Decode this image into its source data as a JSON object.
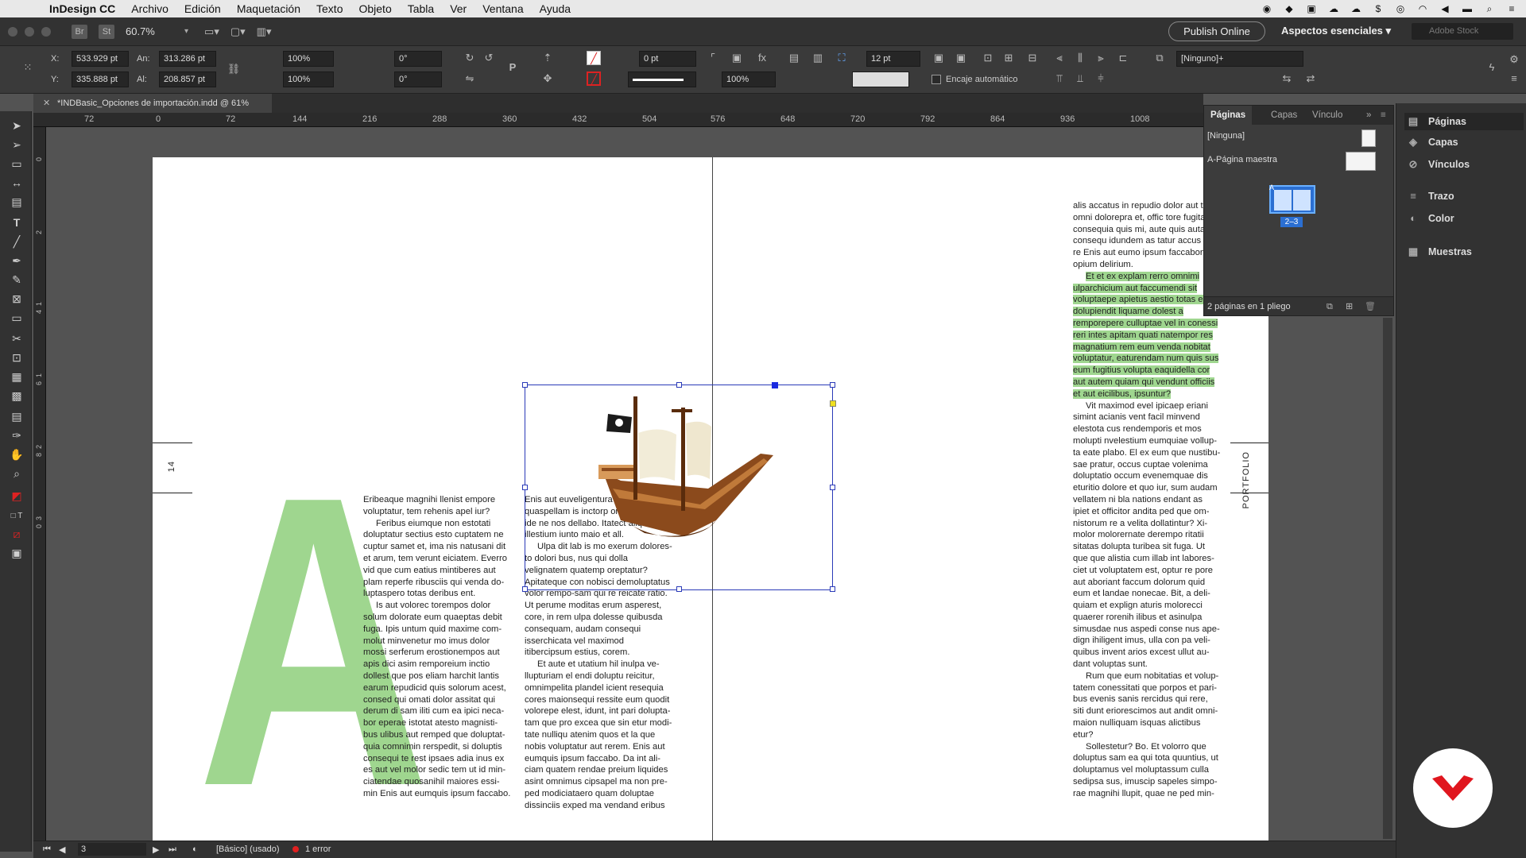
{
  "menubar": {
    "app": "InDesign CC",
    "items": [
      "Archivo",
      "Edición",
      "Maquetación",
      "Texto",
      "Objeto",
      "Tabla",
      "Ver",
      "Ventana",
      "Ayuda"
    ]
  },
  "appbar": {
    "bridge": "Br",
    "stock": "St",
    "zoom": "60.7%",
    "publish": "Publish Online",
    "workspace": "Aspectos esenciales",
    "search_placeholder": "Adobe Stock"
  },
  "control": {
    "x_label": "X:",
    "x_value": "533.929 pt",
    "y_label": "Y:",
    "y_value": "335.888 pt",
    "w_label": "An:",
    "w_value": "313.286 pt",
    "h_label": "Al:",
    "h_value": "208.857 pt",
    "scale_x": "100%",
    "scale_y": "100%",
    "angle": "0°",
    "shear": "0°",
    "stroke_weight": "0 pt",
    "opacity": "100%",
    "spacing": "12 pt",
    "style": "[Ninguno]+",
    "autofit_label": "Encaje automático"
  },
  "document": {
    "tab_title": "*INDBasic_Opciones de importación.indd @ 61%"
  },
  "ruler": {
    "h_ticks": [
      "72",
      "0",
      "72",
      "144",
      "216",
      "288",
      "360",
      "432",
      "504",
      "576",
      "648",
      "720",
      "792",
      "864",
      "936",
      "1008"
    ],
    "v_ticks": [
      "0",
      "2",
      "1",
      "4",
      "1",
      "6",
      "2",
      "8",
      "3",
      "0",
      "3",
      "2",
      "3",
      "4",
      "3",
      "6",
      "3",
      "8"
    ]
  },
  "spread": {
    "big_letter": "A",
    "left_folio": "14",
    "right_label": "PORTFOLIO",
    "col1": [
      "Eribeaque magnihi llenist empore voluptatur, tem rehenis apel iur?",
      "Feribus eiumque non estotati doluptatur sectius esto cuptatem ne cuptur samet et, ima nis natusani dit et arum, tem verunt eiciatem. Everro vid que cum eatius mintiberes aut plam reperfe ribusciis qui venda do-luptaspero totas deribus ent.",
      "Is aut volorec torempos dolor solum dolorate eum quaeptas debit fuga. Ipis untum quid maxime com-molut minvenetur mo imus dolor mossi serferum erostionempos aut apis dici asim remporeium inctio dollest que pos eliam harchit lantis earum repudicid quis solorum acest, consed qui omati dolor assitat qui derum di sam iliti cum ea ipici neca-bor eperae istotat atesto magnisti-bus ulibus aut remped que doluptat-quia comnimin rerspedit, si doluptis consequi te rest ipsaes adia inus ex es aut vel molor sedic tem ut id min-ciatendae quosanihil maiores essi-min Enis aut eumquis ipsum faccabo."
    ],
    "col2": [
      "Enis aut euveligentura cumquia quaspellam is inctorp orempori del ide ne nos dellabo. Itatect aliquidu illestium iunto maio et all.",
      "Ulpa dit lab is mo exerum dolores-to dolori bus, nus qui dolla velignatem quatemp oreptatur? Apitateque con nobisci demoluptatus volor rempo-sam qui re reicate ratio. Ut perume moditas erum asperest, core, in rem ulpa dolesse quibusda consequam, audam consequi isserchicata vel maximod itibercipsum estius, corem.",
      "Et aute et utatium hil inulpa ve-llupturiam el endi doluptu reicitur, omnimpelita plandel icient resequia cores maionsequi ressite eum quodit volorepe elest, idunt, int pari dolupta-tam que pro excea que sin etur modi-tate nulliqu atenim quos et la que nobis voluptatur aut rerem. Enis aut eumquis ipsum faccabo. Da int ali-ciam quatem rendae preium liquides asint omnimus cipsapel ma non pre-ped modiciataero quam doluptae dissinciis exped ma vendand eribus"
    ],
    "col3_top": "alis accatus in repudio dolor aut ti tet omni dolorepra et, offic tore fugitam, consequia quis mi, aute quis autatia consequ idundem as tatur accus dias re Enis aut eumo ipsum faccabortex opium delirium.",
    "col3_highlight": "Et et ex explam rerro omnimi ulparchicium aut faccumendi sit voluptaepe apietus aestio totas e dae dolupiendit liquame dolest a remporepere culluptae vel in conessi reri intes apitam quati natempor res magnatium rem eum venda nobitat voluptatur, eaturendam num quis sus eum fugitius volupta eaquidella cor aut autem quiam qui vendunt officiis et aut eicilibus, ipsuntur?",
    "col3_rest": [
      "Vit maximod evel ipicaep eriani simint acianis vent facil minvend elestota cus rendemporis et mos molupti nvelestium eumquiae vollup-ta eate plabo. El ex eum que nustibu-sae pratur, occus cuptae volenima doluptatio occum evenemquae dis eturitio dolore et quo iur, sum audam vellatem ni bla nations endant as ipiet et officitor andita ped que om-nistorum re a velita dollatintur? Xi-molor molorernate derempo ritatii sitatas dolupta turibea sit fuga. Ut que que alistia cum illab int labores-ciet ut voluptatem est, optur re pore aut aboriant faccum dolorum quid eum et landae nonecae. Bit, a deli-quiam et explign aturis molorecci quaerer rorenih ilibus et asinulpa simusdae nus aspedi conse nus ape-dign ihiligent imus, ulla con pa veli-quibus invent arios excest ullut au-dant voluptas sunt.",
      "Rum que eum nobitatias et volup-tatem conessitati que porpos et pari-bus evenis sanis rercidus qui rere, siti dunt eriorescimos aut andit omni-maion nulliquam isquas alictibus etur?",
      "Sollestetur? Bo. Et volorro que doluptus sam ea qui tota quuntius, ut doluptamus vel moluptassum culla sedipsa sus, imuscip sapeles simpo-rae magnihi llupit, quae ne ped min-"
    ]
  },
  "pages_panel": {
    "tabs": [
      "Páginas",
      "Capas",
      "Vínculo"
    ],
    "none_label": "[Ninguna]",
    "master_label": "A-Página maestra",
    "spread_label": "2–3",
    "thumb_letter": "A",
    "footer": "2 páginas en 1 pliego"
  },
  "dock": {
    "items": [
      "Páginas",
      "Capas",
      "Vínculos",
      "Trazo",
      "Color",
      "Muestras"
    ]
  },
  "status": {
    "page": "3",
    "profile": "[Básico] (usado)",
    "errors": "1 error"
  },
  "colors": {
    "accent_green": "#9fd68f",
    "selection_blue": "#2a3ab8",
    "logo_red": "#e0161e"
  }
}
